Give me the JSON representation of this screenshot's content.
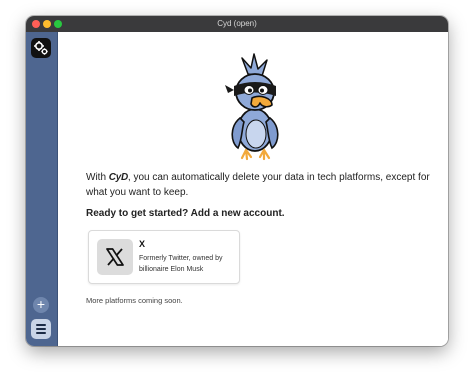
{
  "window": {
    "title": "Cyd (open)"
  },
  "sidebar": {
    "account_icon": "gears-icon",
    "add_button_label": "+",
    "menu_icon": "hamburger-icon"
  },
  "main": {
    "intro_prefix": "With ",
    "intro_logo": "CyD",
    "intro_suffix": ", you can automatically delete your data in tech platforms, except for what you want to keep.",
    "cta": "Ready to get started? Add a new account.",
    "card": {
      "name": "X",
      "description": "Formerly Twitter, owned by billionaire Elon Musk",
      "icon": "x-logo-icon"
    },
    "more_text": "More platforms coming soon."
  },
  "colors": {
    "sidebar": "#4e6690",
    "titlebar": "#3a3a3c",
    "mascot_body": "#8fa9d8",
    "mascot_beak": "#f2a93b"
  }
}
